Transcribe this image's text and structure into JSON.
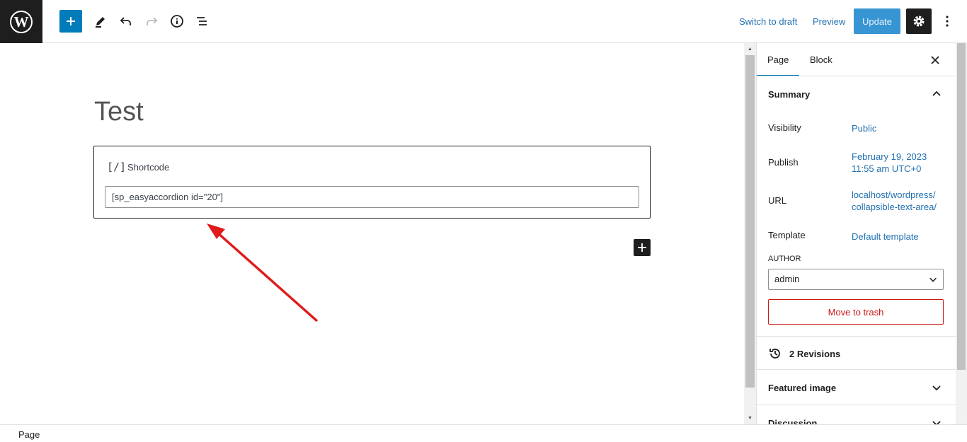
{
  "toolbar": {
    "switch_to_draft": "Switch to draft",
    "preview": "Preview",
    "update": "Update"
  },
  "editor": {
    "title": "Test",
    "block": {
      "icon": "[/]",
      "label": "Shortcode",
      "value": "[sp_easyaccordion id=\"20\"]"
    }
  },
  "sidebar": {
    "tabs": [
      {
        "label": "Page",
        "active": true
      },
      {
        "label": "Block",
        "active": false
      }
    ],
    "summary": {
      "title": "Summary",
      "rows": [
        {
          "label": "Visibility",
          "value": "Public"
        },
        {
          "label": "Publish",
          "value_line1": "February 19, 2023",
          "value_line2": "11:55 am UTC+0"
        },
        {
          "label": "URL",
          "value_line1": "localhost/wordpress/",
          "value_line2": "collapsible-text-area/"
        },
        {
          "label": "Template",
          "value": "Default template"
        }
      ],
      "author_label": "AUTHOR",
      "author_value": "admin",
      "trash": "Move to trash"
    },
    "revisions": "2 Revisions",
    "featured_image": "Featured image",
    "discussion": "Discussion"
  },
  "footer": {
    "breadcrumb": "Page"
  },
  "colors": {
    "accent": "#007cba",
    "link": "#2271b1",
    "danger": "#cc1818",
    "arrow": "#e01b1b"
  }
}
